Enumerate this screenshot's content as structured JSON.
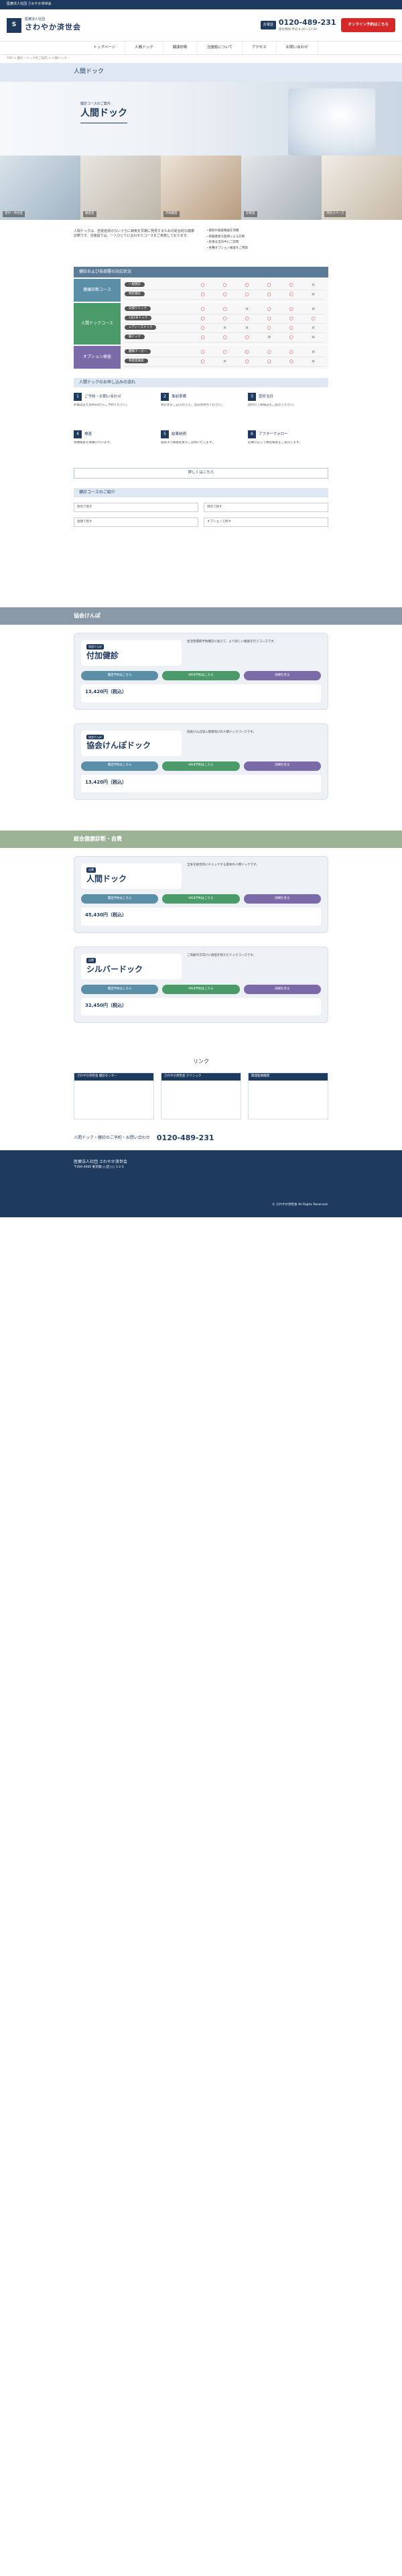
{
  "topbar": {
    "text": "医療法人社団 さわやか済世会"
  },
  "header": {
    "logo_mark": "S",
    "logo_line1": "医療法人社団",
    "logo_line2": "さわやか済世会",
    "tel_label": "お電話",
    "tel_number": "0120-489-231",
    "tel_hours": "受付時間 平日 8:30〜17:00",
    "cta": "オンライン予約はこちら"
  },
  "nav": [
    "トップページ",
    "人間ドック",
    "健康診断",
    "当施設について",
    "アクセス",
    "お問い合わせ"
  ],
  "breadcrumb": "TOP > 健診・ドックのご案内 > 人間ドック",
  "page_title": "人間ドック",
  "hero": {
    "sub": "健診コースのご案内",
    "main": "人間ドック"
  },
  "photos": [
    {
      "cap": "受付・待合室"
    },
    {
      "cap": "検査室"
    },
    {
      "cap": "内視鏡室"
    },
    {
      "cap": "診察室"
    },
    {
      "cap": "待合スペース"
    }
  ],
  "intro": {
    "para": "人間ドックは、自覚症状のないうちに病気を早期に発見するための総合的な健康診断です。当施設では、一人ひとりに合わせたコースをご用意しております。",
    "points": [
      "・最新の検査機器を完備",
      "・経験豊富な医師による診断",
      "・結果は当日中にご説明",
      "・各種オプション検査をご用意"
    ]
  },
  "table": {
    "head": "健診および各部署の対応状況",
    "groups": [
      {
        "side": "健康診断コース",
        "color": "#5b8fa8",
        "rows": [
          {
            "lbl": "一般健診",
            "marks": [
              "○",
              "○",
              "○",
              "○",
              "○",
              "×"
            ]
          },
          {
            "lbl": "特定健診",
            "marks": [
              "○",
              "○",
              "○",
              "○",
              "○",
              "×"
            ]
          }
        ]
      },
      {
        "side": "人間ドックコース",
        "color": "#4a9a6a",
        "rows": [
          {
            "lbl": "日帰りドック",
            "marks": [
              "○",
              "○",
              "×",
              "○",
              "○",
              "×"
            ]
          },
          {
            "lbl": "1泊2日ドック",
            "marks": [
              "○",
              "○",
              "○",
              "○",
              "○",
              "○"
            ]
          },
          {
            "lbl": "レディースドック",
            "marks": [
              "○",
              "×",
              "×",
              "○",
              "○",
              "×"
            ]
          },
          {
            "lbl": "脳ドック",
            "marks": [
              "○",
              "○",
              "○",
              "×",
              "○",
              "×"
            ]
          }
        ]
      },
      {
        "side": "オプション検査",
        "color": "#7a6aa8",
        "rows": [
          {
            "lbl": "腫瘍マーカー",
            "marks": [
              "○",
              "○",
              "○",
              "○",
              "○",
              "×"
            ]
          },
          {
            "lbl": "骨密度検査",
            "marks": [
              "○",
              "×",
              "○",
              "○",
              "○",
              "×"
            ]
          }
        ]
      }
    ]
  },
  "flow": {
    "title": "人間ドックのお申し込みの流れ",
    "steps": [
      {
        "num": "1",
        "ttl": "ご予約・お問い合わせ",
        "txt": "お電話またはWEBからご予約ください。"
      },
      {
        "num": "2",
        "ttl": "事前準備",
        "txt": "問診票をご記入のうえ、当日お持ちください。"
      },
      {
        "num": "3",
        "ttl": "受診当日",
        "txt": "受付にて保険証をご提示ください。"
      },
      {
        "num": "4",
        "ttl": "検査",
        "txt": "各種検査を順番に行います。"
      },
      {
        "num": "5",
        "ttl": "結果説明",
        "txt": "医師より検査結果をご説明いたします。"
      },
      {
        "num": "6",
        "ttl": "アフターフォロー",
        "txt": "必要に応じて精密検査をご案内します。"
      }
    ],
    "more": "詳しくはこちら"
  },
  "search": {
    "title": "健診コースのご紹介",
    "f1": "性別で探す",
    "f2": "目的で探す",
    "f3": "金額で探す",
    "f4": "オプションで探す"
  },
  "band1": "協会けんぽ",
  "band2": "総合健康診断・自費",
  "courses": [
    {
      "tag": "協会けんぽ",
      "name": "付加健診",
      "desc": "生活習慣病予防健診に加えて、より詳しい検査を行うコースです。",
      "price": "13,420円（税込）",
      "btns": [
        "電話予約はこちら",
        "WEB予約はこちら",
        "詳細を見る"
      ]
    },
    {
      "tag": "協会けんぽ",
      "name": "協会けんぽドック",
      "desc": "協会けんぽ加入者様向けの人間ドックコースです。",
      "price": "13,420円（税込）",
      "btns": [
        "電話予約はこちら",
        "WEB予約はこちら",
        "詳細を見る"
      ]
    },
    {
      "tag": "自費",
      "name": "人間ドック",
      "desc": "全身を総合的にチェックする基本の人間ドックです。",
      "price": "45,430円（税込）",
      "btns": [
        "電話予約はこちら",
        "WEB予約はこちら",
        "詳細を見る"
      ]
    },
    {
      "tag": "自費",
      "name": "シルバードック",
      "desc": "ご高齢の方向けに負担を抑えたドックコースです。",
      "price": "32,450円（税込）",
      "btns": [
        "電話予約はこちら",
        "WEB予約はこちら",
        "詳細を見る"
      ]
    }
  ],
  "links": {
    "title": "リンク",
    "cards": [
      "さわやか済世会 健診センター",
      "さわやか済世会 クリニック",
      "関連医療機関"
    ]
  },
  "footer_cta": {
    "lead": "人間ドック・健診のご予約・お問い合わせ",
    "tel": "0120-489-231"
  },
  "footer": {
    "name": "医療法人社団 さわやか済世会",
    "addr": "〒000-0000 東京都○○区○○ 1-2-3",
    "copy": "© さわやか済世会 All Rights Reserved."
  }
}
